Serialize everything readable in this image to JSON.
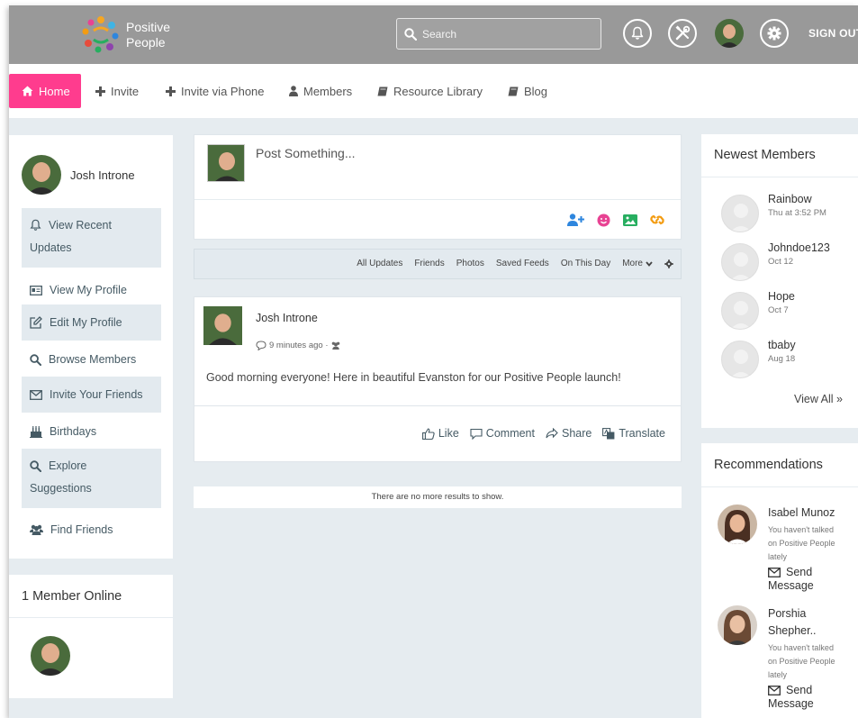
{
  "header": {
    "logo_line1": "Positive",
    "logo_line2": "People",
    "search_placeholder": "Search",
    "signout_label": "SIGN OUT"
  },
  "nav": {
    "home": "Home",
    "invite": "Invite",
    "invite_phone": "Invite via Phone",
    "members": "Members",
    "resource_library": "Resource Library",
    "blog": "Blog"
  },
  "sidebar": {
    "user_name": "Josh Introne",
    "menu": {
      "view_recent_updates_1": "View Recent",
      "view_recent_updates_2": "Updates",
      "view_my_profile": "View My Profile",
      "edit_my_profile": "Edit My Profile",
      "browse_members": "Browse Members",
      "invite_friends": "Invite Your Friends",
      "birthdays": "Birthdays",
      "explore_1": "Explore",
      "explore_2": "Suggestions",
      "find_friends": "Find Friends"
    },
    "online_title": "1 Member Online"
  },
  "feed": {
    "compose_placeholder": "Post Something...",
    "filters": {
      "all_updates": "All Updates",
      "friends": "Friends",
      "photos": "Photos",
      "saved_feeds": "Saved Feeds",
      "on_this_day": "On This Day",
      "more": "More"
    },
    "post": {
      "author": "Josh Introne",
      "time": "9 minutes ago ·",
      "text": "Good morning everyone! Here in beautiful Evanston for our Positive People launch!",
      "like": "Like",
      "comment": "Comment",
      "share": "Share",
      "translate": "Translate"
    },
    "no_more": "There are no more results to show."
  },
  "newest_members": {
    "title": "Newest Members",
    "members": [
      {
        "name": "Rainbow",
        "date": "Thu at 3:52 PM"
      },
      {
        "name": "Johndoe123",
        "date": "Oct 12"
      },
      {
        "name": "Hope",
        "date": "Oct 7"
      },
      {
        "name": "tbaby",
        "date": "Aug 18"
      }
    ],
    "view_all": "View All »"
  },
  "recommendations": {
    "title": "Recommendations",
    "people": [
      {
        "name_1": "Isabel Munoz",
        "name_2": "",
        "note_1": "You haven't talked",
        "note_2": "on Positive People",
        "note_3": "lately",
        "send_1": "Send",
        "send_2": "Message"
      },
      {
        "name_1": "Porshia",
        "name_2": "Shepher..",
        "note_1": "You haven't talked",
        "note_2": "on Positive People",
        "note_3": "lately",
        "send_1": "Send",
        "send_2": "Message"
      }
    ]
  },
  "colors": {
    "header_bg": "#999999",
    "home_accent": "#ff3c8e",
    "page_bg": "#e6ecf0"
  }
}
